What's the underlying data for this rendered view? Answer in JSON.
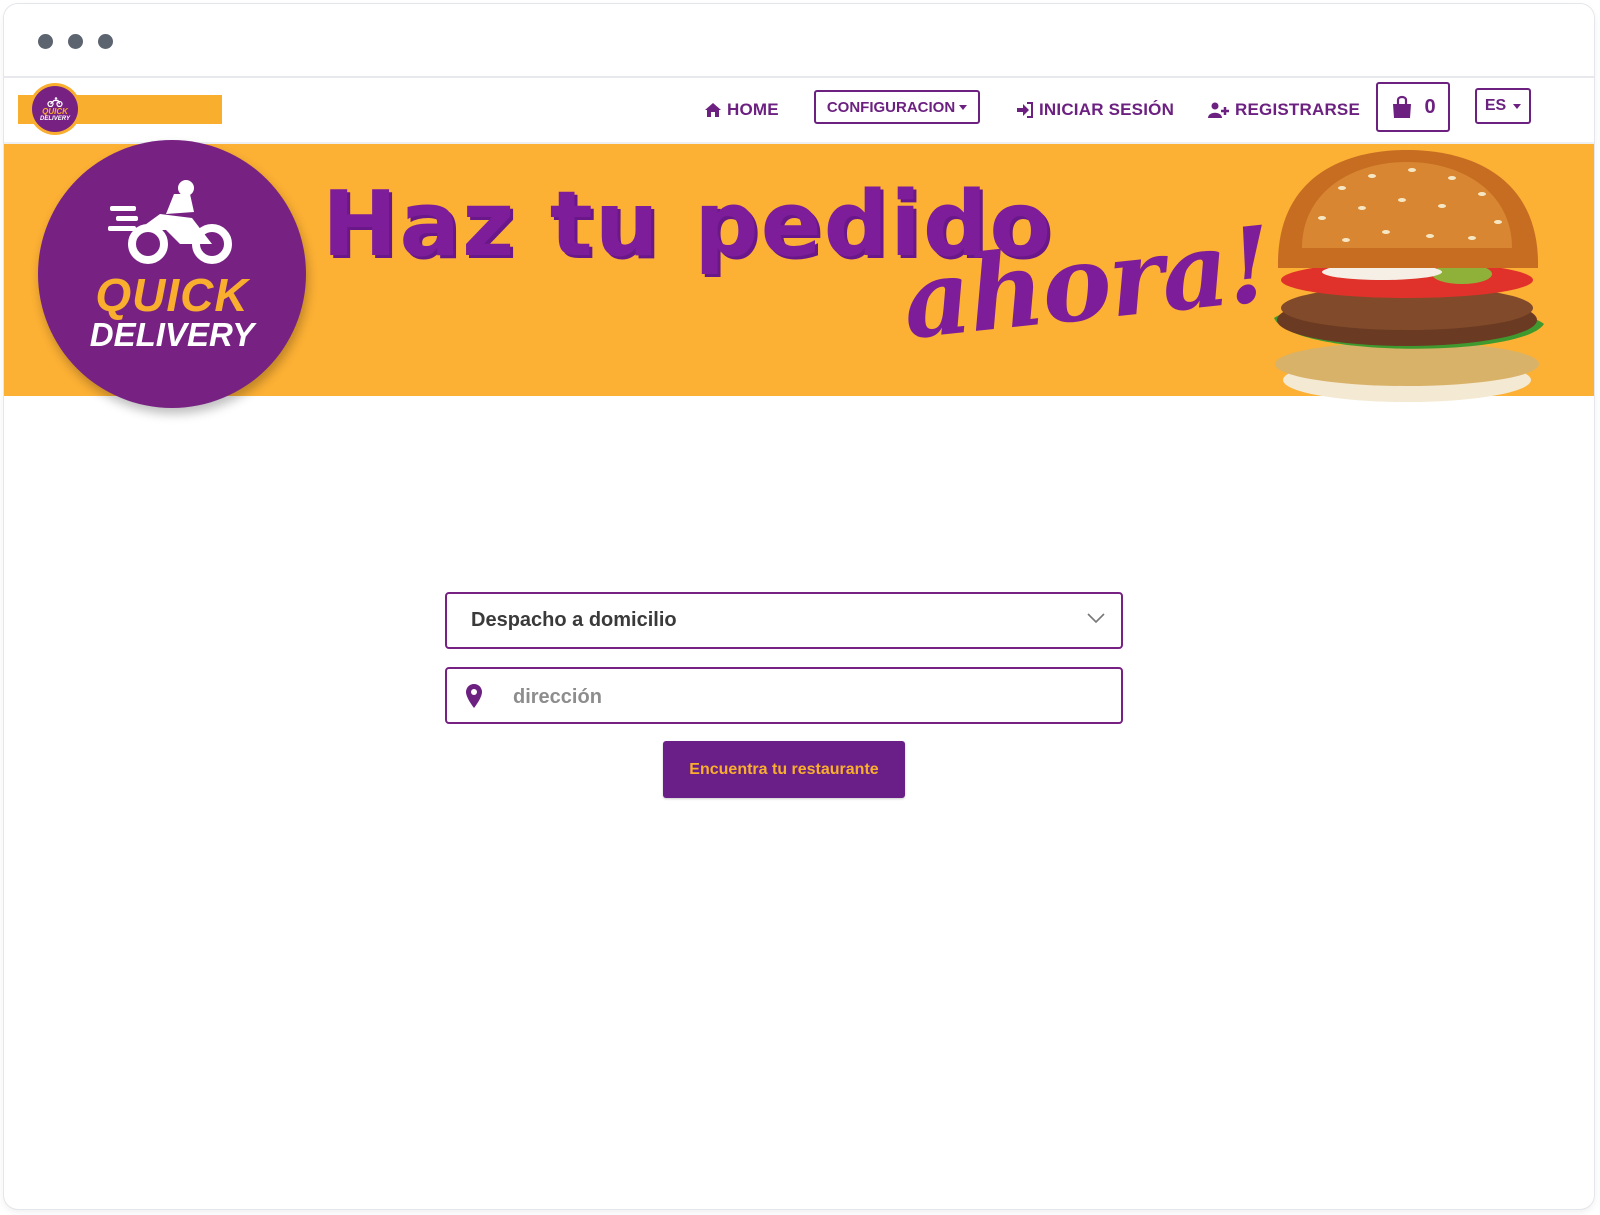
{
  "window": {
    "controls": [
      "dot",
      "dot",
      "dot"
    ]
  },
  "nav": {
    "logo_line1": "QUICK",
    "logo_line2": "DELIVERY",
    "home": "HOME",
    "config": "CONFIGURACION",
    "login": "INICIAR SESIÓN",
    "register": "REGISTRARSE",
    "cart_count": "0",
    "language": "ES"
  },
  "banner": {
    "logo_line1": "QUICK",
    "logo_line2": "DELIVERY",
    "headline": "Haz tu pedido",
    "headline_script": "ahora!",
    "colors": {
      "background": "#fcb034",
      "purple": "#772283"
    }
  },
  "search": {
    "delivery_type": "Despacho a domicilio",
    "address_value": "",
    "address_placeholder": "dirección",
    "submit_label": "Encuentra tu restaurante"
  }
}
